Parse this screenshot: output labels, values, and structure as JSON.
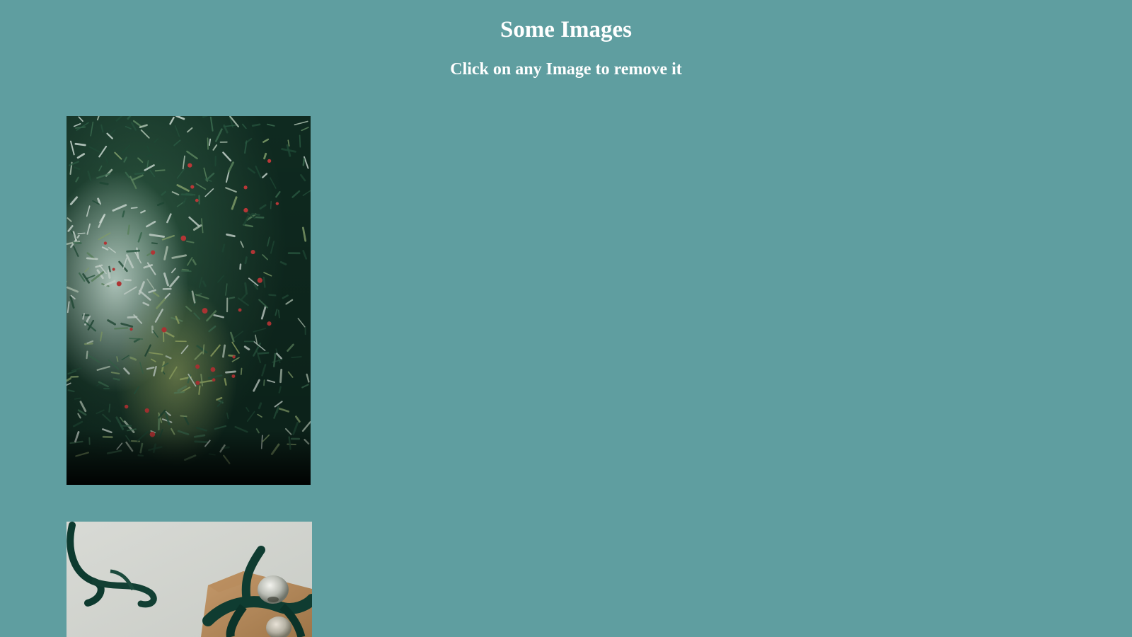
{
  "header": {
    "title": "Some Images",
    "instruction": "Click on any Image to remove it"
  },
  "colors": {
    "background": "#5f9ea0",
    "text": "#ffffff"
  },
  "images": [
    {
      "subject": "evergreen branches with red berries"
    },
    {
      "subject": "gift wrapped in kraft paper with dark green velvet ribbon and silver bell"
    }
  ]
}
